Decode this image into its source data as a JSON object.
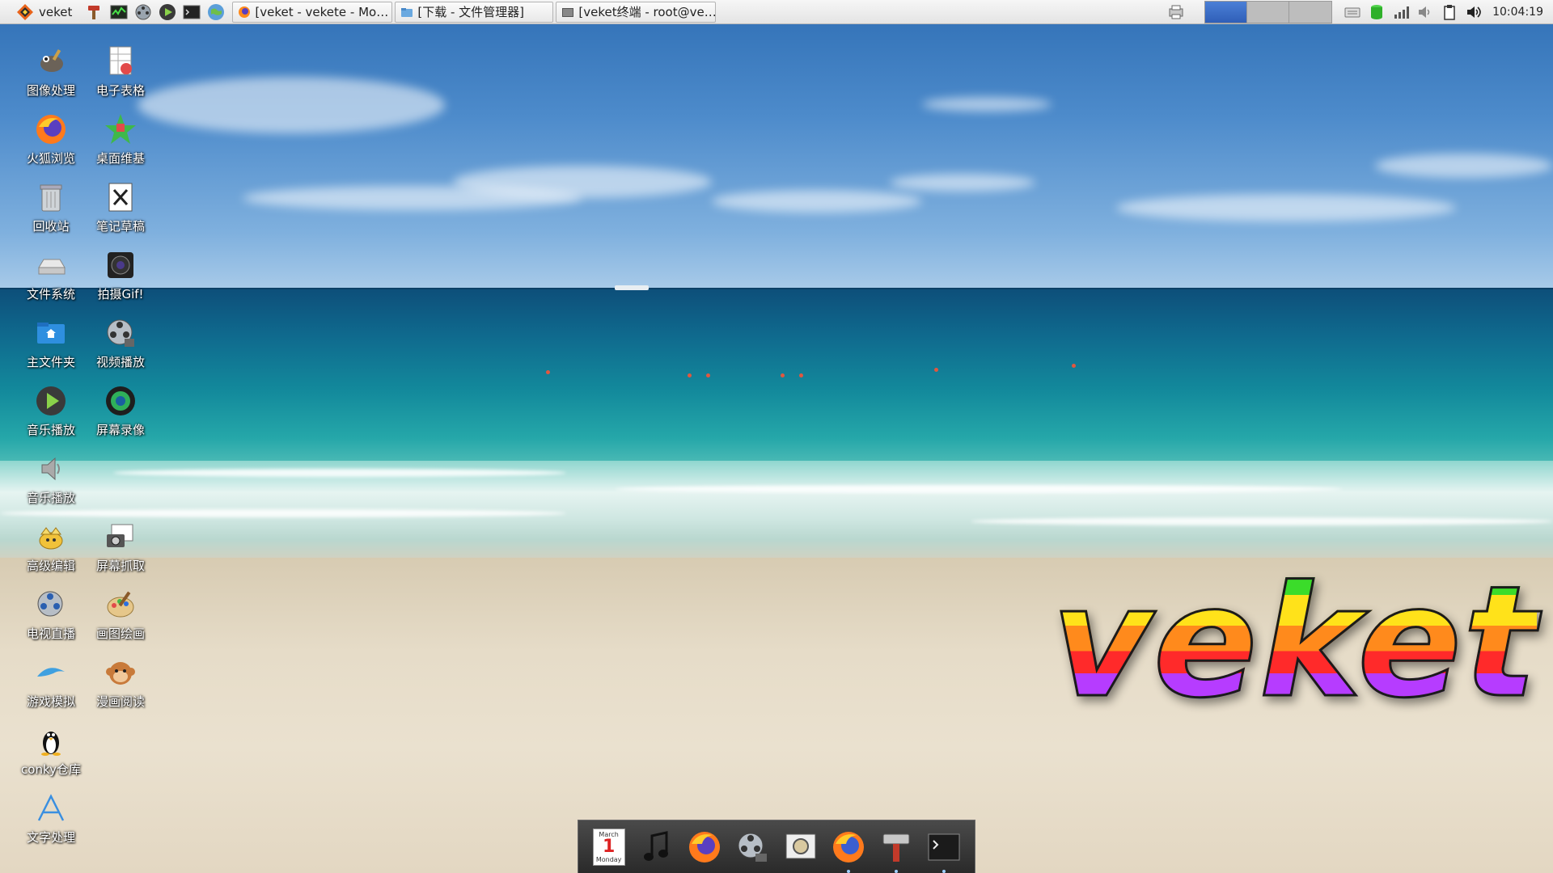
{
  "panel": {
    "menu_label": "veket",
    "tasks": [
      {
        "label": "[veket - vekete - Mo…"
      },
      {
        "label": "[下载 - 文件管理器]"
      },
      {
        "label": "[veket终端 - root@ve…"
      }
    ],
    "clock": "10:04:19",
    "active_desktop": 1,
    "desktop_count": 3
  },
  "desktop": {
    "icons": [
      {
        "label": "图像处理"
      },
      {
        "label": "电子表格"
      },
      {
        "label": "火狐浏览"
      },
      {
        "label": "桌面维基"
      },
      {
        "label": "回收站"
      },
      {
        "label": "笔记草稿"
      },
      {
        "label": "文件系统"
      },
      {
        "label": "拍摄Gif!"
      },
      {
        "label": "主文件夹"
      },
      {
        "label": "视频播放"
      },
      {
        "label": "音乐播放"
      },
      {
        "label": "屏幕录像"
      },
      {
        "label": "音乐播放"
      },
      {
        "label": "高级编辑"
      },
      {
        "label": "屏幕抓取"
      },
      {
        "label": "电视直播"
      },
      {
        "label": "画图绘画"
      },
      {
        "label": "游戏模拟"
      },
      {
        "label": "漫画阅读"
      },
      {
        "label": "conky仓库"
      },
      {
        "label": "文字处理"
      }
    ]
  },
  "dock": {
    "calendar": {
      "month": "March",
      "day": "1",
      "weekday": "Monday"
    }
  },
  "wallpaper": {
    "logo_text": "veket"
  },
  "colors": {
    "panel_bg": "#e9e9e9",
    "active_desktop": "#3a6cc6",
    "dock_bg": "#333333"
  }
}
